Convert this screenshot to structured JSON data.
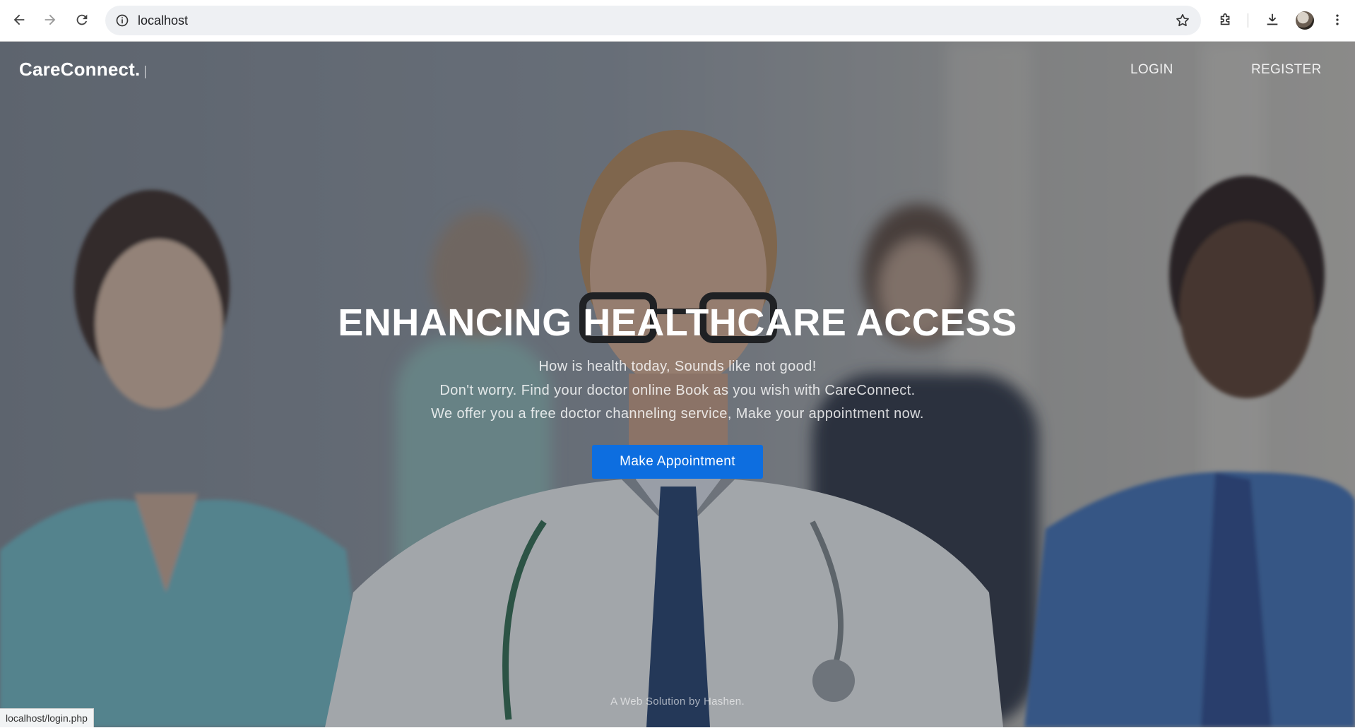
{
  "browser": {
    "url": "localhost",
    "status_url": "localhost/login.php"
  },
  "icons": {
    "back": "back-arrow-icon",
    "forward": "forward-arrow-icon",
    "reload": "reload-icon",
    "site_info": "info-icon",
    "bookmark": "star-icon",
    "extensions": "puzzle-icon",
    "downloads": "download-icon",
    "profile": "avatar",
    "menu": "kebab-menu-icon"
  },
  "site": {
    "brand": "CareConnect.",
    "nav": {
      "login": "LOGIN",
      "register": "REGISTER"
    },
    "hero": {
      "headline": "ENHANCING HEALTHCARE ACCESS",
      "lines": [
        "How is health today, Sounds like not good!",
        "Don't worry. Find your doctor online Book as you wish with CareConnect.",
        "We offer you a free doctor channeling service, Make your appointment now."
      ],
      "cta": "Make Appointment"
    },
    "footer": "A Web Solution by Hashen."
  },
  "colors": {
    "cta": "#0d6ee0",
    "overlay": "rgba(40,44,52,0.38)",
    "chrome_bg": "#ffffff",
    "omnibox_bg": "#eef0f3"
  }
}
